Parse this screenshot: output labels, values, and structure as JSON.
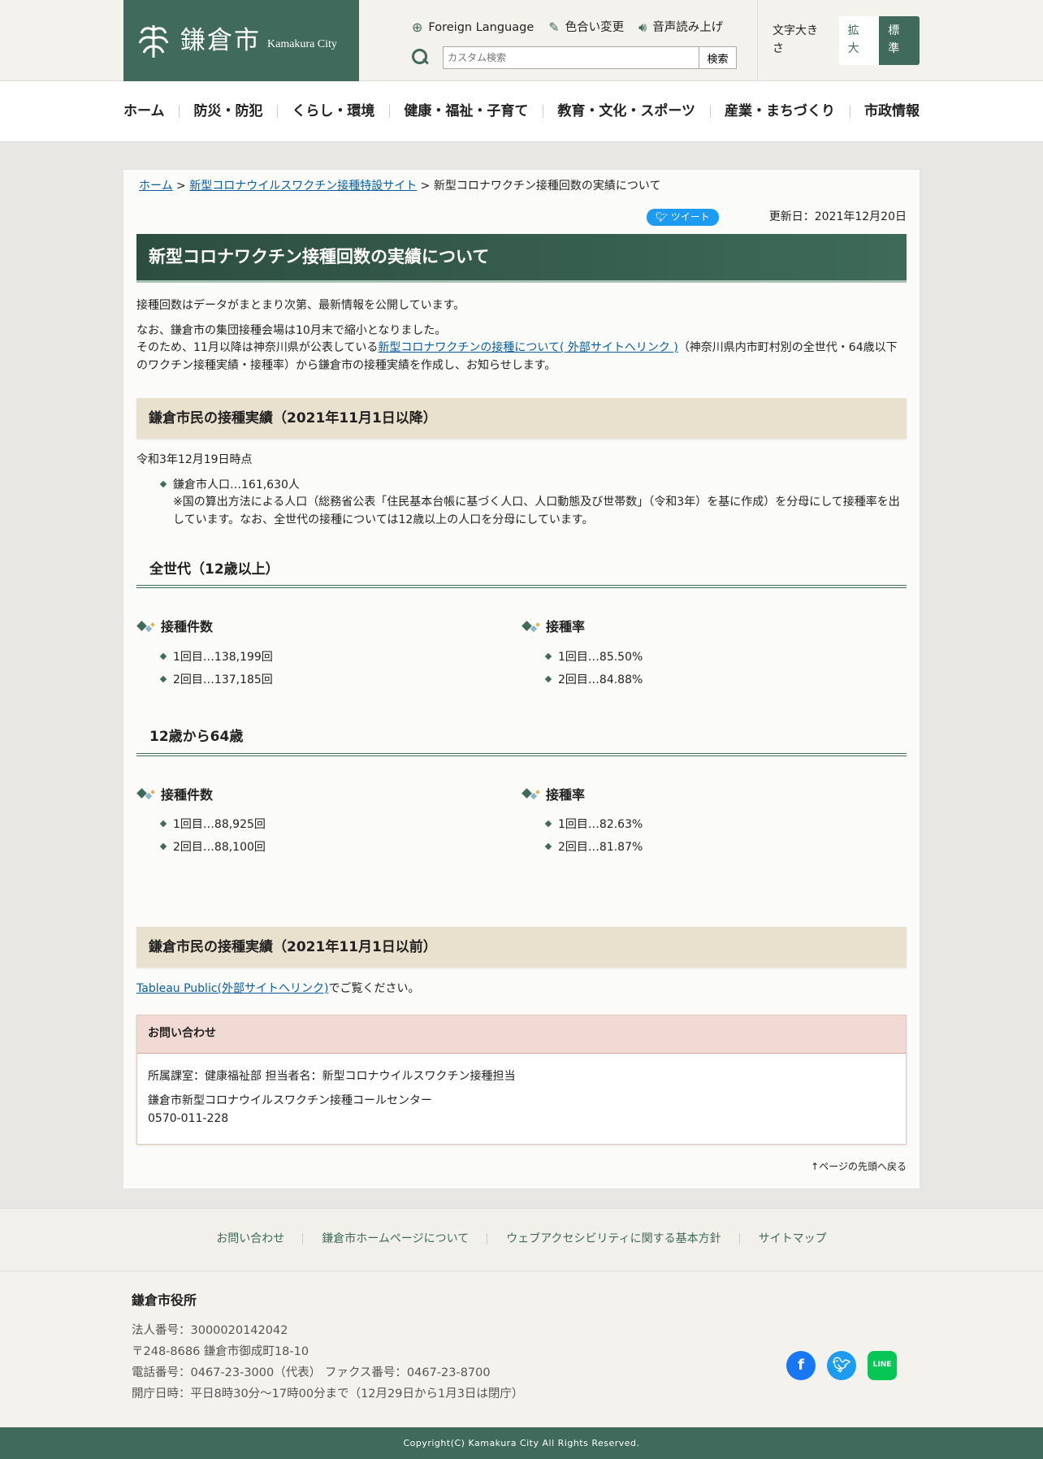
{
  "header": {
    "logo_jp": "鎌倉市",
    "logo_en": "Kamakura City",
    "foreign_language": "Foreign Language",
    "color_change": "色合い変更",
    "speech": "音声読み上げ",
    "search_placeholder": "カスタム検索",
    "search_button": "検索",
    "font_size_label": "文字大きさ",
    "font_large": "拡大",
    "font_normal": "標準"
  },
  "nav": [
    "ホーム",
    "防災・防犯",
    "くらし・環境",
    "健康・福祉・子育て",
    "教育・文化・スポーツ",
    "産業・まちづくり",
    "市政情報"
  ],
  "breadcrumb": {
    "home": "ホーム",
    "sep": " > ",
    "parent": "新型コロナウイルスワクチン接種特設サイト",
    "current": "新型コロナワクチン接種回数の実績について"
  },
  "tweet": "ツイート",
  "updated": "更新日：2021年12月20日",
  "title": "新型コロナワクチン接種回数の実績について",
  "intro1": "接種回数はデータがまとまり次第、最新情報を公開しています。",
  "intro2a": "なお、鎌倉市の集団接種会場は10月末で縮小となりました。",
  "intro2b": "そのため、11月以降は神奈川県が公表している",
  "intro2link": "新型コロナワクチンの接種について( 外部サイトへリンク )",
  "intro2c": "（神奈川県内市町村別の全世代・64歳以下のワクチン接種実績・接種率）から鎌倉市の接種実績を作成し、お知らせします。",
  "sec1": {
    "heading": "鎌倉市民の接種実績（2021年11月1日以降）",
    "asof": "令和3年12月19日時点",
    "pop": "鎌倉市人口…161,630人",
    "note": "※国の算出方法による人口（総務省公表「住民基本台帳に基づく人口、人口動態及び世帯数」（令和3年）を基に作成）を分母にして接種率を出しています。なお、全世代の接種については12歳以上の人口を分母にしています。"
  },
  "groups": [
    {
      "heading": "全世代（12歳以上）",
      "count_h": "接種件数",
      "counts": [
        "1回目…138,199回",
        "2回目…137,185回"
      ],
      "rate_h": "接種率",
      "rates": [
        "1回目…85.50%",
        "2回目…84.88%"
      ]
    },
    {
      "heading": "12歳から64歳",
      "count_h": "接種件数",
      "counts": [
        "1回目…88,925回",
        "2回目…88,100回"
      ],
      "rate_h": "接種率",
      "rates": [
        "1回目…82.63%",
        "2回目…81.87%"
      ]
    }
  ],
  "sec2": {
    "heading": "鎌倉市民の接種実績（2021年11月1日以前）",
    "link": "Tableau Public(外部サイトへリンク)",
    "tail": "でご覧ください。"
  },
  "contact": {
    "heading": "お問い合わせ",
    "dept": "所属課室：健康福祉部 担当者名：新型コロナウイルスワクチン接種担当",
    "center": "鎌倉市新型コロナウイルスワクチン接種コールセンター",
    "tel": "0570-011-228"
  },
  "totop": "ページの先頭へ戻る",
  "footer_links": [
    "お問い合わせ",
    "鎌倉市ホームページについて",
    "ウェブアクセシビリティに関する基本方針",
    "サイトマップ"
  ],
  "office": {
    "name": "鎌倉市役所",
    "lines": [
      "法人番号：3000020142042",
      "〒248-8686 鎌倉市御成町18-10",
      "電話番号：0467-23-3000（代表） ファクス番号：0467-23-8700",
      "開庁日時：平日8時30分～17時00分まで（12月29日から1月3日は閉庁）"
    ]
  },
  "copyright": "Copyright(C) Kamakura City All Rights Reserved.",
  "colors": {
    "brand": "#3f6a5c",
    "link": "#0a5d9c"
  }
}
